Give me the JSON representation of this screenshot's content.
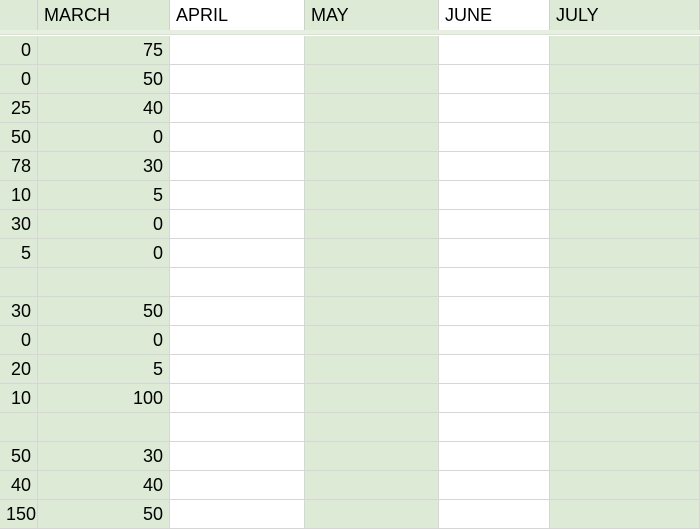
{
  "headers": {
    "feb": "",
    "march": "MARCH",
    "april": "APRIL",
    "may": "MAY",
    "june": "JUNE",
    "july": "JULY"
  },
  "rows": [
    {
      "a": "0",
      "b": "75",
      "c": "",
      "d": "",
      "e": "",
      "f": ""
    },
    {
      "a": "0",
      "b": "50",
      "c": "",
      "d": "",
      "e": "",
      "f": ""
    },
    {
      "a": "25",
      "b": "40",
      "c": "",
      "d": "",
      "e": "",
      "f": ""
    },
    {
      "a": "50",
      "b": "0",
      "c": "",
      "d": "",
      "e": "",
      "f": ""
    },
    {
      "a": "78",
      "b": "30",
      "c": "",
      "d": "",
      "e": "",
      "f": ""
    },
    {
      "a": "10",
      "b": "5",
      "c": "",
      "d": "",
      "e": "",
      "f": ""
    },
    {
      "a": "30",
      "b": "0",
      "c": "",
      "d": "",
      "e": "",
      "f": ""
    },
    {
      "a": "5",
      "b": "0",
      "c": "",
      "d": "",
      "e": "",
      "f": ""
    },
    {
      "a": "",
      "b": "",
      "c": "",
      "d": "",
      "e": "",
      "f": ""
    },
    {
      "a": "30",
      "b": "50",
      "c": "",
      "d": "",
      "e": "",
      "f": ""
    },
    {
      "a": "0",
      "b": "0",
      "c": "",
      "d": "",
      "e": "",
      "f": ""
    },
    {
      "a": "20",
      "b": "5",
      "c": "",
      "d": "",
      "e": "",
      "f": ""
    },
    {
      "a": "10",
      "b": "100",
      "c": "",
      "d": "",
      "e": "",
      "f": ""
    },
    {
      "a": "",
      "b": "",
      "c": "",
      "d": "",
      "e": "",
      "f": ""
    },
    {
      "a": "50",
      "b": "30",
      "c": "",
      "d": "",
      "e": "",
      "f": ""
    },
    {
      "a": "40",
      "b": "40",
      "c": "",
      "d": "",
      "e": "",
      "f": ""
    },
    {
      "a": "150",
      "b": "50",
      "c": "",
      "d": "",
      "e": "",
      "f": ""
    }
  ],
  "chart_data": {
    "type": "table",
    "title": "",
    "columns": [
      "MARCH",
      "APRIL",
      "MAY",
      "JUNE",
      "JULY"
    ],
    "prior_column_partial": [
      0,
      0,
      25,
      50,
      78,
      10,
      30,
      5,
      null,
      30,
      0,
      20,
      10,
      null,
      50,
      40,
      150
    ],
    "series": [
      {
        "name": "MARCH",
        "values": [
          75,
          50,
          40,
          0,
          30,
          5,
          0,
          0,
          null,
          50,
          0,
          5,
          100,
          null,
          30,
          40,
          50
        ]
      },
      {
        "name": "APRIL",
        "values": []
      },
      {
        "name": "MAY",
        "values": []
      },
      {
        "name": "JUNE",
        "values": []
      },
      {
        "name": "JULY",
        "values": []
      }
    ]
  }
}
